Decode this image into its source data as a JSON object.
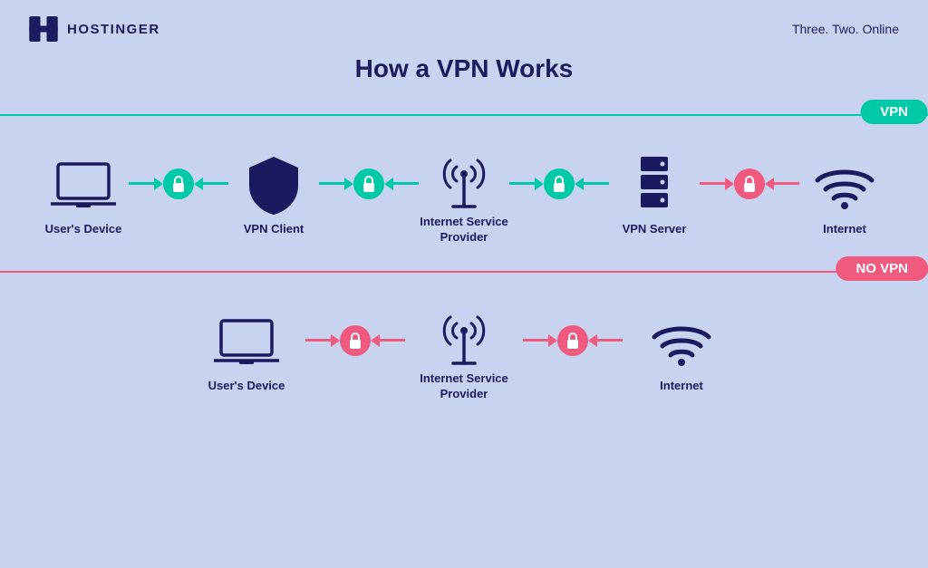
{
  "header": {
    "logo_text": "HOSTINGER",
    "tagline": "Three. Two. Online"
  },
  "main_title": "How a VPN Works",
  "vpn_section": {
    "badge": "VPN",
    "items": [
      {
        "label": "User's Device",
        "icon": "laptop"
      },
      {
        "label": "VPN Client",
        "icon": "shield"
      },
      {
        "label": "Internet Service\nProvider",
        "icon": "antenna"
      },
      {
        "label": "VPN Server",
        "icon": "server"
      },
      {
        "label": "Internet",
        "icon": "wifi"
      }
    ],
    "connectors": [
      "green",
      "green",
      "green",
      "red"
    ]
  },
  "no_vpn_section": {
    "badge": "NO VPN",
    "items": [
      {
        "label": "User's Device",
        "icon": "laptop"
      },
      {
        "label": "Internet Service\nProvider",
        "icon": "antenna"
      },
      {
        "label": "Internet",
        "icon": "wifi"
      }
    ],
    "connectors": [
      "red",
      "red"
    ]
  },
  "colors": {
    "green": "#00c9a7",
    "red": "#f05a7e",
    "dark_navy": "#1a1a5e",
    "bg": "#c8d3f0"
  }
}
